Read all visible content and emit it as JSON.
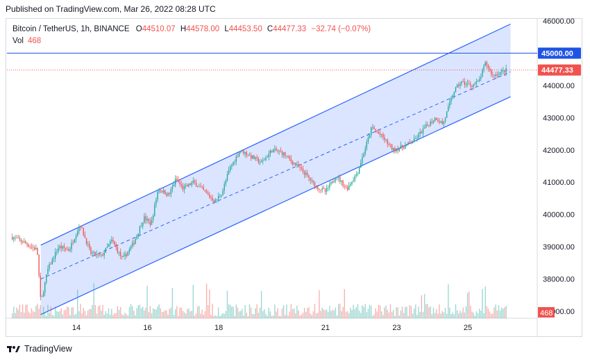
{
  "header": {
    "published": "Published on TradingView.com, Mar 26, 2022 08:28 UTC"
  },
  "legend": {
    "symbol": "Bitcoin / TetherUS, 1h, BINANCE",
    "open_label": "O",
    "open": "44510.07",
    "high_label": "H",
    "high": "44578.00",
    "low_label": "L",
    "low": "44453.50",
    "close_label": "C",
    "close": "44477.33",
    "change": "−32.74 (−0.07%)",
    "vol_label": "Vol",
    "vol": "468"
  },
  "footer": {
    "brand": "TradingView"
  },
  "colors": {
    "up": "#26a69a",
    "down": "#ef5350",
    "channel": "#2962ff",
    "fill": "#cfdcff",
    "level": "#1e53e5"
  },
  "chart_data": {
    "type": "candlestick",
    "symbol": "BTCUSDT",
    "interval": "1h",
    "ylim": [
      37000,
      46000
    ],
    "y_ticks": [
      "46000.00",
      "45000.00",
      "44000.00",
      "43000.00",
      "42000.00",
      "41000.00",
      "40000.00",
      "39000.00",
      "38000.00",
      "37000.00"
    ],
    "x_ticks": [
      "14",
      "16",
      "18",
      "21",
      "23",
      "25"
    ],
    "horizontal_line": {
      "value": 45000.0,
      "label": "45000.00"
    },
    "last_price": {
      "value": 44477.33,
      "label": "44477.33"
    },
    "volume_last": {
      "label": "468"
    },
    "channel": {
      "upper": [
        [
          13.0,
          39050
        ],
        [
          26.2,
          45900
        ]
      ],
      "middle": [
        [
          13.0,
          38000
        ],
        [
          26.2,
          44420
        ]
      ],
      "lower": [
        [
          13.0,
          36900
        ],
        [
          26.2,
          43650
        ]
      ]
    },
    "price_path": [
      [
        12.2,
        39300
      ],
      [
        12.5,
        39150
      ],
      [
        12.9,
        38900
      ],
      [
        13.0,
        37250
      ],
      [
        13.2,
        38300
      ],
      [
        13.5,
        39000
      ],
      [
        13.8,
        38900
      ],
      [
        14.1,
        39700
      ],
      [
        14.4,
        38800
      ],
      [
        14.7,
        38700
      ],
      [
        15.0,
        39200
      ],
      [
        15.3,
        38600
      ],
      [
        15.6,
        39100
      ],
      [
        15.9,
        39900
      ],
      [
        16.1,
        39700
      ],
      [
        16.3,
        40800
      ],
      [
        16.6,
        40600
      ],
      [
        16.8,
        41100
      ],
      [
        17.0,
        40800
      ],
      [
        17.3,
        41000
      ],
      [
        17.6,
        40700
      ],
      [
        17.9,
        40400
      ],
      [
        18.1,
        40700
      ],
      [
        18.3,
        41400
      ],
      [
        18.6,
        42000
      ],
      [
        18.9,
        41800
      ],
      [
        19.2,
        41600
      ],
      [
        19.5,
        42000
      ],
      [
        19.8,
        41900
      ],
      [
        20.1,
        41600
      ],
      [
        20.4,
        41300
      ],
      [
        20.7,
        40900
      ],
      [
        21.0,
        40700
      ],
      [
        21.3,
        41200
      ],
      [
        21.6,
        40800
      ],
      [
        21.9,
        41300
      ],
      [
        22.1,
        42000
      ],
      [
        22.3,
        42700
      ],
      [
        22.6,
        42400
      ],
      [
        22.9,
        42000
      ],
      [
        23.2,
        42100
      ],
      [
        23.5,
        42300
      ],
      [
        23.8,
        42700
      ],
      [
        24.1,
        43000
      ],
      [
        24.3,
        42800
      ],
      [
        24.6,
        43800
      ],
      [
        24.8,
        44100
      ],
      [
        25.1,
        44000
      ],
      [
        25.3,
        44100
      ],
      [
        25.5,
        44700
      ],
      [
        25.7,
        44300
      ],
      [
        25.9,
        44400
      ],
      [
        26.1,
        44480
      ]
    ]
  }
}
